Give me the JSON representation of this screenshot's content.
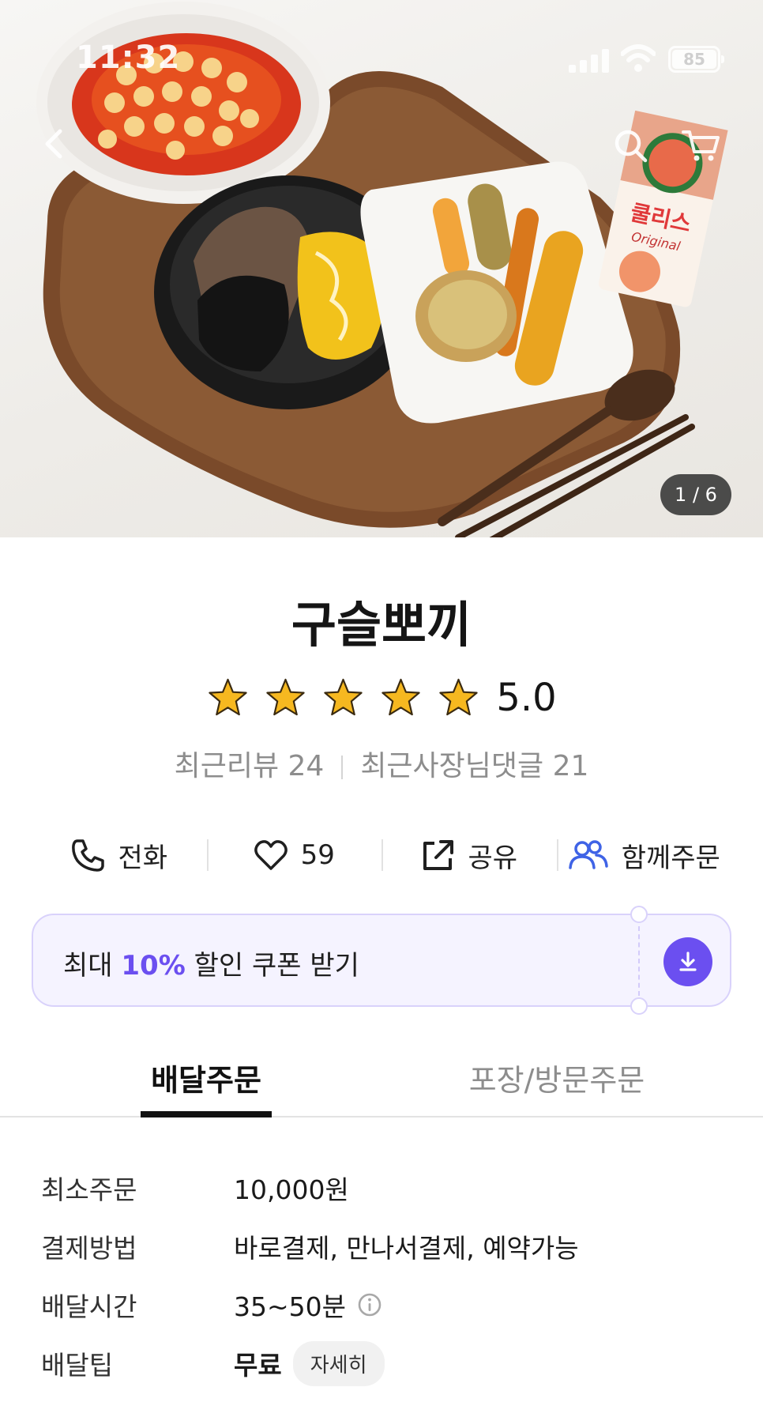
{
  "status_bar": {
    "time": "11:32",
    "battery": "85"
  },
  "hero": {
    "counter": "1 / 6",
    "carton_brand": "쿨리스",
    "carton_sub": "Original"
  },
  "store": {
    "name": "구슬뽀끼",
    "rating": "5.0",
    "rating_value": 5.0,
    "star_count": 5,
    "recent_reviews": "최근리뷰 24",
    "owner_replies": "최근사장님댓글 21"
  },
  "actions": {
    "call": "전화",
    "likes": "59",
    "share": "공유",
    "group_order": "함께주문"
  },
  "coupon": {
    "prefix": "최대",
    "percent": "10%",
    "suffix": "할인 쿠폰 받기"
  },
  "tabs": {
    "delivery": "배달주문",
    "pickup": "포장/방문주문"
  },
  "info": {
    "min_order_label": "최소주문",
    "min_order_value": "10,000원",
    "payment_label": "결제방법",
    "payment_value": "바로결제, 만나서결제, 예약가능",
    "time_label": "배달시간",
    "time_value": "35~50분",
    "tip_label": "배달팁",
    "tip_value": "무료",
    "tip_detail": "자세히"
  },
  "colors": {
    "accent": "#6b4ff0",
    "coupon_bg": "#f5f3ff",
    "star": "#f6b820",
    "group_icon": "#3f63e6"
  }
}
